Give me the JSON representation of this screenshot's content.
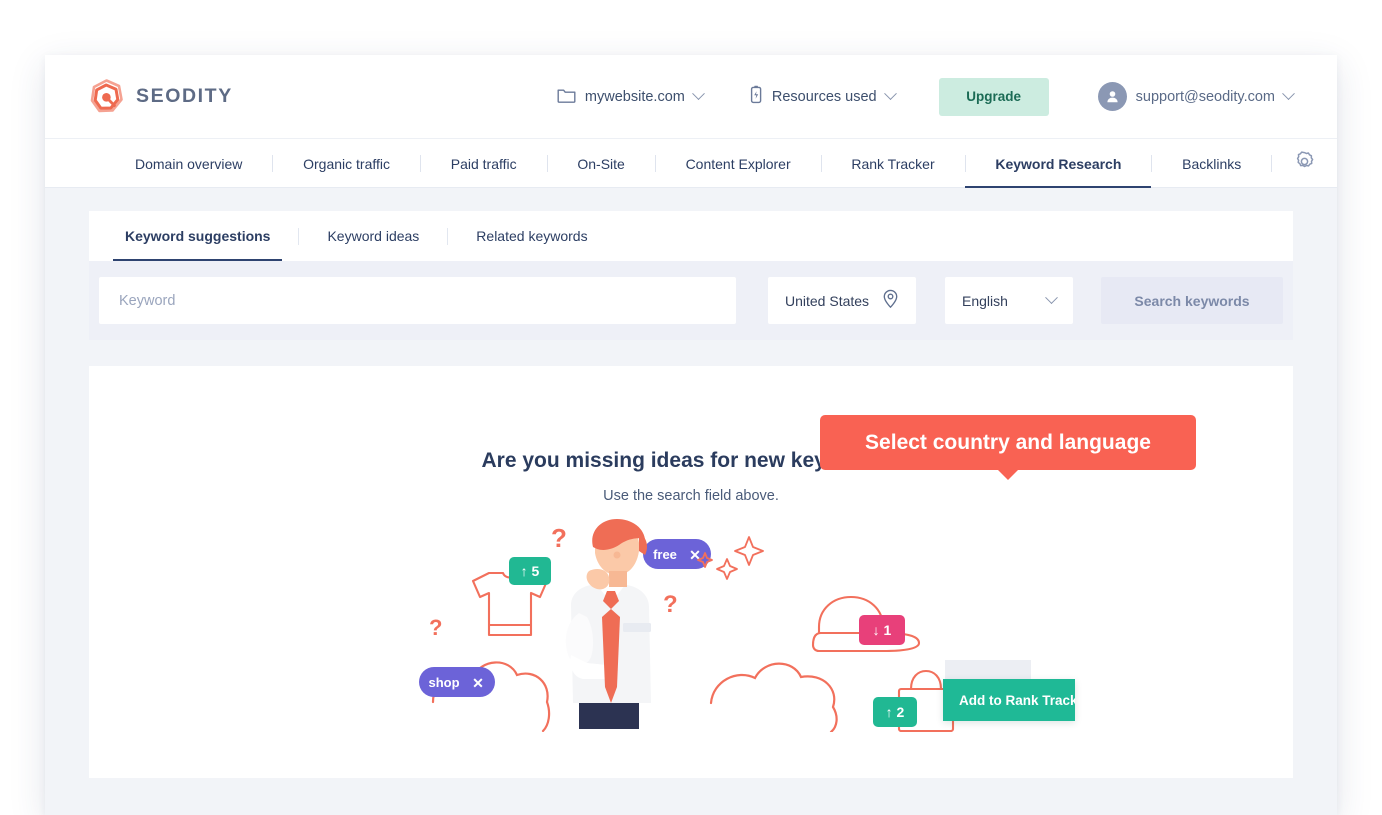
{
  "brand": {
    "name": "SEODITY",
    "logo_icon": "seodity-hexagon-magnifier-logo",
    "accent": "#f96253",
    "logo_text_color": "#5e6b85"
  },
  "topbar": {
    "site_selector": {
      "label": "mywebsite.com",
      "icon": "folder-icon",
      "chevron": "chevron-down-icon"
    },
    "resources": {
      "label": "Resources used",
      "icon": "battery-icon",
      "chevron": "chevron-down-icon"
    },
    "upgrade_label": "Upgrade",
    "upgrade_bg": "#ccece0",
    "upgrade_color": "#1b6b55",
    "account": {
      "email": "support@seodity.com",
      "icon": "user-avatar-icon",
      "chevron": "chevron-down-icon"
    }
  },
  "nav": {
    "items": [
      {
        "label": "Domain overview",
        "active": false
      },
      {
        "label": "Organic traffic",
        "active": false
      },
      {
        "label": "Paid traffic",
        "active": false
      },
      {
        "label": "On-Site",
        "active": false
      },
      {
        "label": "Content Explorer",
        "active": false
      },
      {
        "label": "Rank Tracker",
        "active": false
      },
      {
        "label": "Keyword Research",
        "active": true
      },
      {
        "label": "Backlinks",
        "active": false
      }
    ],
    "settings_icon": "gear-icon",
    "active_underline_color": "#2e4370"
  },
  "tabs": {
    "items": [
      {
        "label": "Keyword suggestions",
        "active": true
      },
      {
        "label": "Keyword ideas",
        "active": false
      },
      {
        "label": "Related keywords",
        "active": false
      }
    ]
  },
  "tooltip": {
    "text": "Select country and language",
    "bg": "#f96253",
    "color": "#ffffff"
  },
  "search": {
    "keyword_placeholder": "Keyword",
    "keyword_value": "",
    "country": {
      "value": "United States",
      "icon": "location-pin-icon"
    },
    "language": {
      "value": "English",
      "icon": "chevron-down-icon"
    },
    "submit_label": "Search keywords",
    "submit_disabled": true
  },
  "empty_state": {
    "title": "Are you missing ideas for new keywords?",
    "subtitle": "Use the search field above.",
    "illustration": {
      "name": "thinking-man-keywords-illustration",
      "badges": [
        {
          "label": "↑ 5",
          "color": "#21b893",
          "attached_to": "tshirt-icon"
        },
        {
          "label": "free ✕",
          "color": "#6c63d8",
          "attached_to": "keyword-pill"
        },
        {
          "label": "↓ 1",
          "color": "#e8407a",
          "attached_to": "cap-icon"
        },
        {
          "label": "↑ 2",
          "color": "#21b893",
          "attached_to": "shopping-bag-icon"
        },
        {
          "label": "shop ✕",
          "color": "#6c63d8",
          "attached_to": "keyword-pill"
        }
      ],
      "question_marks": 3
    }
  },
  "floating_action": {
    "label": "Add to Rank Tracker",
    "bg": "#1fb996",
    "color": "#ffffff"
  }
}
